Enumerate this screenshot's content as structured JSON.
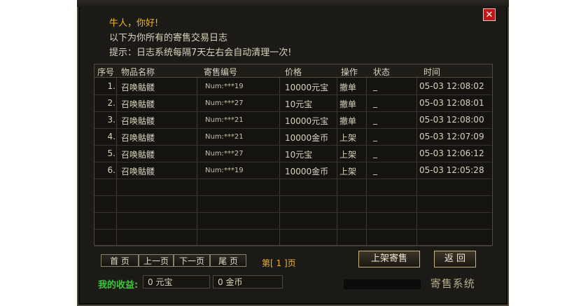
{
  "window": {
    "greeting": "牛人，你好!",
    "intro": "以下为你所有的寄售交易日志",
    "tip": "提示：日志系统每隔7天左右会自动清理一次!",
    "close_glyph": "✕"
  },
  "table": {
    "headers": [
      "序号",
      "物品名称",
      "寄售编号",
      "价格",
      "操作",
      "状态",
      "时间"
    ],
    "rows": [
      {
        "idx": "1.",
        "item": "召唤骷髅",
        "sale_id": "Num:***19",
        "price": "10000元宝",
        "action": "撤单",
        "status": "_",
        "time": "05-03 12:08:02"
      },
      {
        "idx": "2.",
        "item": "召唤骷髅",
        "sale_id": "Num:***27",
        "price": "10元宝",
        "action": "撤单",
        "status": "_",
        "time": "05-03 12:08:01"
      },
      {
        "idx": "3.",
        "item": "召唤骷髅",
        "sale_id": "Num:***21",
        "price": "10000元宝",
        "action": "撤单",
        "status": "_",
        "time": "05-03 12:08:00"
      },
      {
        "idx": "4.",
        "item": "召唤骷髅",
        "sale_id": "Num:***21",
        "price": "10000金币",
        "action": "上架",
        "status": "_",
        "time": "05-03 12:07:09"
      },
      {
        "idx": "5.",
        "item": "召唤骷髅",
        "sale_id": "Num:***27",
        "price": "10元宝",
        "action": "上架",
        "status": "_",
        "time": "05-03 12:06:12"
      },
      {
        "idx": "6.",
        "item": "召唤骷髅",
        "sale_id": "Num:***19",
        "price": "10000金币",
        "action": "上架",
        "status": "_",
        "time": "05-03 12:05:28"
      }
    ]
  },
  "pager": {
    "first": "首 页",
    "prev": "上一页",
    "next": "下一页",
    "last": "尾 页",
    "page_info": "第[ 1 ]页"
  },
  "actions": {
    "list_sale": "上架寄售",
    "back": "返 回"
  },
  "earnings": {
    "label": "我的收益:",
    "yuanbao": "0 元宝",
    "gold": "0 金币"
  },
  "watermark": {
    "text": "寄售系统"
  },
  "colors": {
    "accent": "#f0b42a",
    "earn_label": "#3cc43c",
    "close": "#c21616"
  }
}
